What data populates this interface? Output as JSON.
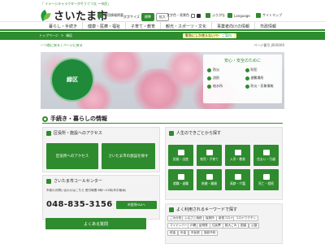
{
  "header": {
    "mascot_note": "「 イメージキャラクターがそうてつ太 ～市民」",
    "logo_text": "さいたま市",
    "util": {
      "recruit": "採用情報掲載",
      "char_size_label": "文字サイズ",
      "char_std": "標準",
      "char_large": "拡大",
      "color_label": "文字色・背景色",
      "language": "Language",
      "sitemap": "サイトマップ",
      "mascot_link": "ふりがな"
    }
  },
  "gnav": [
    "暮らし・手続き",
    "健康・医療・福祉",
    "子育て・教育",
    "観光・スポーツ・文化",
    "事業者向けの情報",
    "市政情報"
  ],
  "breadcrumb": {
    "top": "トップページ",
    "current": "緑区",
    "notice": "緊急にしか使えないページの利用",
    "notice2": "ご案内"
  },
  "subhead": {
    "link": "一つ前に戻る | ページに戻る",
    "page_id": "ページ番号 J000000"
  },
  "hero": {
    "ward_name": "緑区",
    "safety_title": "安心・安全のために",
    "safety_items": [
      "防災",
      "防犯",
      "消防",
      "避難場所",
      "給水所",
      "防災・気象情報"
    ]
  },
  "section": {
    "title": "手続き・暮らしの情報"
  },
  "access": {
    "title": "区役所・施設へのアクセス",
    "btn_office": "区役所へのアクセス",
    "btn_facilities": "さいたま市の施設を探す"
  },
  "callcenter": {
    "title": "さいたま市コールセンター",
    "desc": "市政のお問い合わせはこちら 受付時間 8時～21時(年中無休)",
    "phone": "048-835-3156",
    "mail_btn": "市役所FAXへ",
    "faq_btn": "よくある質問"
  },
  "life": {
    "title": "人生のできごとから探す",
    "tiles": [
      "妊娠・出産",
      "育児・子育て",
      "入学・教育",
      "住まい・引越",
      "就職・退職",
      "結婚・離婚",
      "高齢・介護",
      "死亡・相続"
    ]
  },
  "keywords": {
    "title": "よく利用されるキーワードで探す",
    "items": [
      "ごみ分別",
      "ふるさと納税",
      "保育所",
      "新型コロナ",
      "コロナワクチン",
      "マイナンバー",
      "戸籍",
      "証明書",
      "住民票",
      "粗大ごみ",
      "国保",
      "公園",
      "税金",
      "年金",
      "市民税",
      "施設予約"
    ]
  },
  "colors": {
    "brand_green": "#2e8b2e",
    "notice_yellow": "#fff59d"
  }
}
